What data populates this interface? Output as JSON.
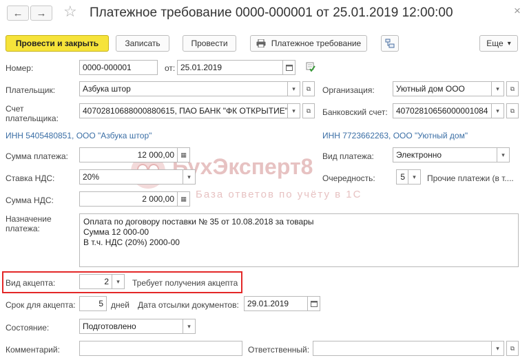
{
  "window": {
    "title": "Платежное требование 0000-000001 от 25.01.2019 12:00:00",
    "close_glyph": "×",
    "star_glyph": "☆",
    "back_glyph": "←",
    "forward_glyph": "→"
  },
  "toolbar": {
    "post_close_label": "Провести и закрыть",
    "save_label": "Записать",
    "post_label": "Провести",
    "print_label": "Платежное требование",
    "more_label": "Еще",
    "dropdown_glyph": "▾"
  },
  "watermark": {
    "brand": "БухЭксперт8",
    "tagline": "База ответов по учёту в 1С"
  },
  "form": {
    "number": {
      "label": "Номер:",
      "value": "0000-000001"
    },
    "date": {
      "label": "от:",
      "value": "25.01.2019"
    },
    "payer": {
      "label": "Плательщик:",
      "value": "Азбука штор"
    },
    "organization": {
      "label": "Организация:",
      "value": "Уютный дом ООО"
    },
    "payer_account": {
      "label_line1": "Счет",
      "label_line2": "плательщика:",
      "value": "40702810688000880615, ПАО БАНК \"ФК ОТКРЫТИЕ\""
    },
    "bank_account": {
      "label": "Банковский счет:",
      "value": "40702810656000001084"
    },
    "payer_inn_link": "ИНН 5405480851, ООО \"Азбука штор\"",
    "org_inn_link": "ИНН 7723662263, ООО \"Уютный дом\"",
    "amount": {
      "label": "Сумма платежа:",
      "value": "12 000,00"
    },
    "payment_type": {
      "label": "Вид платежа:",
      "value": "Электронно"
    },
    "vat_rate": {
      "label": "Ставка НДС:",
      "value": "20%"
    },
    "priority": {
      "label": "Очередность:",
      "value": "5",
      "note": "Прочие платежи (в т...."
    },
    "vat_amount": {
      "label": "Сумма НДС:",
      "value": "2 000,00"
    },
    "purpose": {
      "label_line1": "Назначение",
      "label_line2": "платежа:",
      "lines": [
        "Оплата по договору поставки № 35 от 10.08.2018  за товары",
        "Сумма 12 000-00",
        "В т.ч. НДС  (20%) 2000-00"
      ]
    },
    "acceptance_type": {
      "label": "Вид акцепта:",
      "value": "2",
      "note": "Требует получения акцепта"
    },
    "acceptance_term": {
      "label": "Срок для акцепта:",
      "value": "5",
      "unit": "дней"
    },
    "docs_date": {
      "label": "Дата отсылки документов:",
      "value": "29.01.2019"
    },
    "status": {
      "label": "Состояние:",
      "value": "Подготовлено"
    },
    "comment": {
      "label": "Комментарий:",
      "value": ""
    },
    "responsible": {
      "label": "Ответственный:",
      "value": ""
    }
  },
  "colors": {
    "primary_button": "#f6e33a",
    "link": "#3a6ea5",
    "highlight_box": "#e32727",
    "watermark": "#e7c2c2"
  }
}
